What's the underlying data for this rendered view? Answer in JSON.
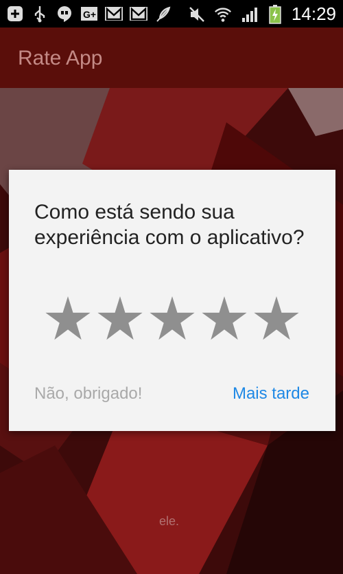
{
  "status_bar": {
    "time": "14:29",
    "left_icons": [
      "add-box-icon",
      "usb-icon",
      "hangouts-icon",
      "google-plus-icon",
      "gmail-icon",
      "gmail-icon",
      "feather-icon"
    ],
    "right_icons": [
      "muted-icon",
      "wifi-icon",
      "signal-icon",
      "battery-charging-icon"
    ]
  },
  "app_bar": {
    "title": "Rate App"
  },
  "background": {
    "caption": "ele."
  },
  "dialog": {
    "question": "Como está sendo sua experiência com o aplicativo?",
    "stars": {
      "count": 5,
      "rating": 0,
      "color": "#8f8f8f"
    },
    "buttons": {
      "no_thanks": "Não, obrigado!",
      "later": "Mais tarde"
    }
  },
  "colors": {
    "accent": "#1e88e5",
    "app_bar": "#5a0e0a",
    "dialog_bg": "#f3f3f3"
  }
}
